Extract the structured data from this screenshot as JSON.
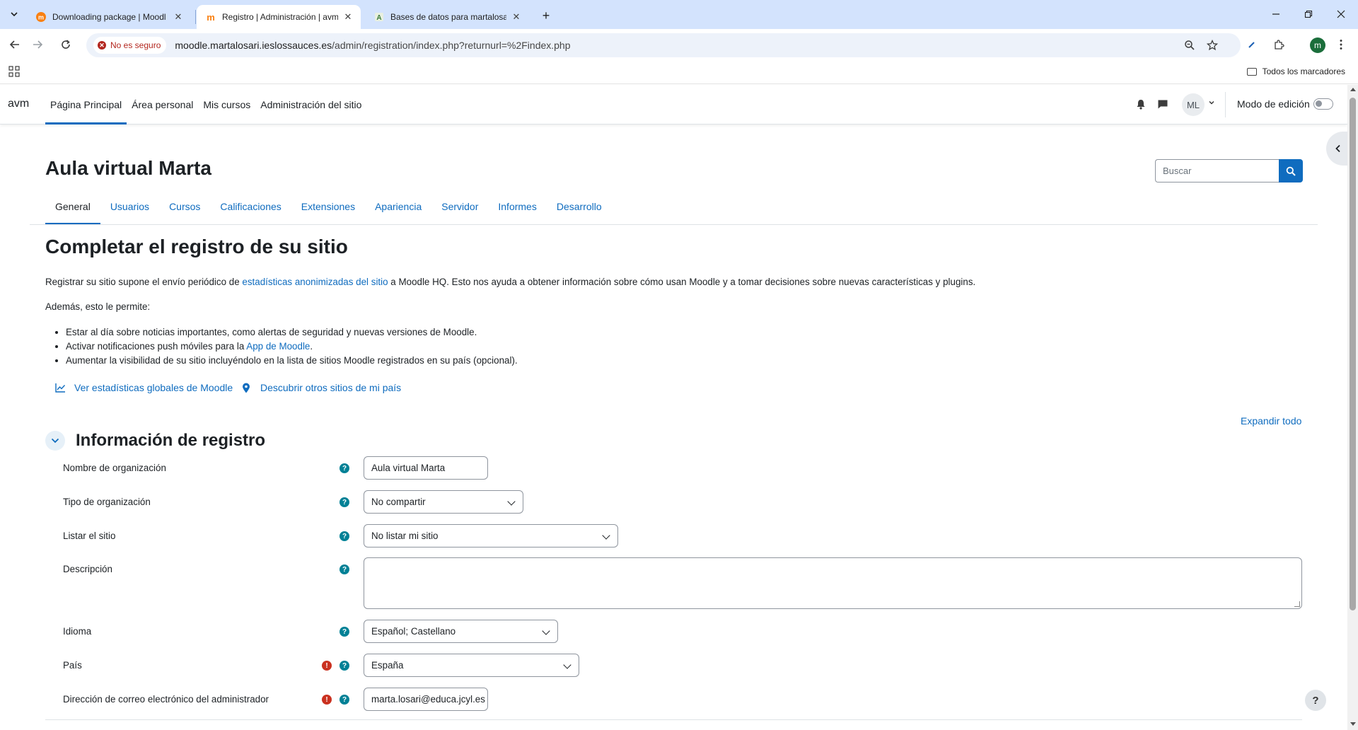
{
  "browser": {
    "tabs": [
      {
        "title": "Downloading package | Moodl",
        "active": false
      },
      {
        "title": "Registro | Administración | avm",
        "active": true
      },
      {
        "title": "Bases de datos para martalosar",
        "active": false
      }
    ],
    "security_label": "No es seguro",
    "url_host": "moodle.martalosari.ieslossauces.es",
    "url_path": "/admin/registration/index.php?returnurl=%2Findex.php",
    "profile_initial": "m",
    "bookmarks_label": "Todos los marcadores"
  },
  "navbar": {
    "brand": "avm",
    "items": [
      {
        "label": "Página Principal",
        "active": true
      },
      {
        "label": "Área personal",
        "active": false
      },
      {
        "label": "Mis cursos",
        "active": false
      },
      {
        "label": "Administración del sitio",
        "active": false
      }
    ],
    "user_initials": "ML",
    "edit_mode_label": "Modo de edición"
  },
  "page": {
    "site_title": "Aula virtual Marta",
    "search_placeholder": "Buscar",
    "secondary_nav": [
      {
        "label": "General",
        "active": true
      },
      {
        "label": "Usuarios",
        "active": false
      },
      {
        "label": "Cursos",
        "active": false
      },
      {
        "label": "Calificaciones",
        "active": false
      },
      {
        "label": "Extensiones",
        "active": false
      },
      {
        "label": "Apariencia",
        "active": false
      },
      {
        "label": "Servidor",
        "active": false
      },
      {
        "label": "Informes",
        "active": false
      },
      {
        "label": "Desarrollo",
        "active": false
      }
    ],
    "heading": "Completar el registro de su sitio",
    "intro_before": "Registrar su sitio supone el envío periódico de ",
    "intro_link": "estadísticas anonimizadas del sitio",
    "intro_after": " a Moodle HQ. Esto nos ayuda a obtener información sobre cómo usan Moodle y a tomar decisiones sobre nuevas características y plugins.",
    "benefits_intro": "Además, esto le permite:",
    "bullet1": "Estar al día sobre noticias importantes, como alertas de seguridad y nuevas versiones de Moodle.",
    "bullet2_before": "Activar notificaciones push móviles para la ",
    "bullet2_link": "App de Moodle",
    "bullet2_after": ".",
    "bullet3": "Aumentar la visibilidad de su sitio incluyéndolo en la lista de sitios Moodle registrados en su país (opcional).",
    "link_stats": "Ver estadísticas globales de Moodle",
    "link_sites": "Descubrir otros sitios de mi país",
    "expand_all": "Expandir todo",
    "section_title": "Información de registro"
  },
  "form": {
    "org_name": {
      "label": "Nombre de organización",
      "value": "Aula virtual Marta"
    },
    "org_type": {
      "label": "Tipo de organización",
      "value": "No compartir"
    },
    "list_site": {
      "label": "Listar el sitio",
      "value": "No listar mi sitio"
    },
    "description": {
      "label": "Descripción",
      "value": ""
    },
    "language": {
      "label": "Idioma",
      "value": "Español; Castellano"
    },
    "country": {
      "label": "País",
      "value": "España"
    },
    "admin_email": {
      "label": "Dirección de correo electrónico del administrador",
      "value": "marta.losari@educa.jcyl.es"
    }
  },
  "colors": {
    "accent": "#0f6cbf",
    "help_icon": "#008196",
    "required_icon": "#ca3120",
    "tabstrip": "#d3e3fd"
  }
}
